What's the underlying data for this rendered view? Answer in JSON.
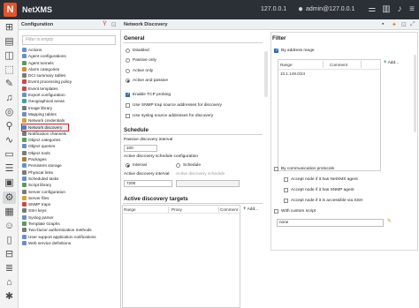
{
  "app": {
    "name": "NetXMS",
    "logo_letter": "N",
    "server": "127.0.0.1",
    "user": "admin@127.0.0.1"
  },
  "config_panel": {
    "title": "Configuration",
    "filter_placeholder": "Filter is empty",
    "items": [
      {
        "label": "Actions",
        "color": "#6a8fc7"
      },
      {
        "label": "Agent configurations",
        "color": "#6a8fc7"
      },
      {
        "label": "Agent tunnels",
        "color": "#5b9b5b"
      },
      {
        "label": "Alarm categories",
        "color": "#d58a3a"
      },
      {
        "label": "DCI summary tables",
        "color": "#7a7a7a"
      },
      {
        "label": "Event processing policy",
        "color": "#c94a4a"
      },
      {
        "label": "Event templates",
        "color": "#c94a4a"
      },
      {
        "label": "Export configuration",
        "color": "#6a8fc7"
      },
      {
        "label": "Geographical areas",
        "color": "#4aa0a0"
      },
      {
        "label": "Image library",
        "color": "#7a7a7a"
      },
      {
        "label": "Mapping tables",
        "color": "#6a8fc7"
      },
      {
        "label": "Network credentials",
        "color": "#d5a23a"
      },
      {
        "label": "Network discovery",
        "color": "#4a7fc9"
      },
      {
        "label": "Notification channels",
        "color": "#7a7a7a"
      },
      {
        "label": "Object categories",
        "color": "#5b9b5b"
      },
      {
        "label": "Object queries",
        "color": "#6a8fc7"
      },
      {
        "label": "Object tools",
        "color": "#7a7a7a"
      },
      {
        "label": "Packages",
        "color": "#b07a3a"
      },
      {
        "label": "Persistent storage",
        "color": "#6a8fc7"
      },
      {
        "label": "Physical links",
        "color": "#7a7a7a"
      },
      {
        "label": "Scheduled tasks",
        "color": "#6a8fc7"
      },
      {
        "label": "Script library",
        "color": "#5b9b5b"
      },
      {
        "label": "Server configuration",
        "color": "#7a7a7a"
      },
      {
        "label": "Server files",
        "color": "#d5a23a"
      },
      {
        "label": "SNMP traps",
        "color": "#c94a4a"
      },
      {
        "label": "SSH keys",
        "color": "#7a7a7a"
      },
      {
        "label": "Syslog parser",
        "color": "#6a8fc7"
      },
      {
        "label": "Template Graphs",
        "color": "#5b9b5b"
      },
      {
        "label": "Two-factor authentication methods",
        "color": "#7a7a7a"
      },
      {
        "label": "User support application notifications",
        "color": "#6a8fc7"
      },
      {
        "label": "Web service definitions",
        "color": "#6a8fc7"
      }
    ]
  },
  "main": {
    "title": "Network Discovery",
    "general": {
      "title": "General",
      "options": [
        "Disabled",
        "Passive only",
        "Active only",
        "Active and passive"
      ],
      "checks": [
        "Enable TCP probing",
        "Use SNMP trap source addresses for discovery",
        "Use syslog source addresses for discovery"
      ]
    },
    "schedule": {
      "title": "Schedule",
      "passive_label": "Passive discovery interval",
      "passive_value": "100",
      "active_conf_label": "Active discovery schedule configuration",
      "interval_label": "Interval",
      "schedule_label": "Schedule",
      "active_interval_label": "Active discovery interval",
      "active_schedule_label": "Active discovery schedule",
      "active_interval_value": "7200"
    },
    "targets": {
      "title": "Active discovery targets",
      "columns": [
        "Range",
        "Proxy",
        "Comment"
      ],
      "add_label": "Add..."
    },
    "filter": {
      "title": "Filter",
      "by_address": "By address range",
      "columns": [
        "Range",
        "Comment"
      ],
      "rows": [
        {
          "range": "10.1.149.0/24",
          "comment": ""
        }
      ],
      "add_label": "Add...",
      "by_protocols": "By communication protocols",
      "protocol_checks": [
        "Accept node if it has NetXMS agent",
        "Accept node if it has SNMP agent",
        "Accept node if it is accessible via SSH"
      ],
      "custom_script": "With custom script",
      "script_value": "none"
    }
  }
}
